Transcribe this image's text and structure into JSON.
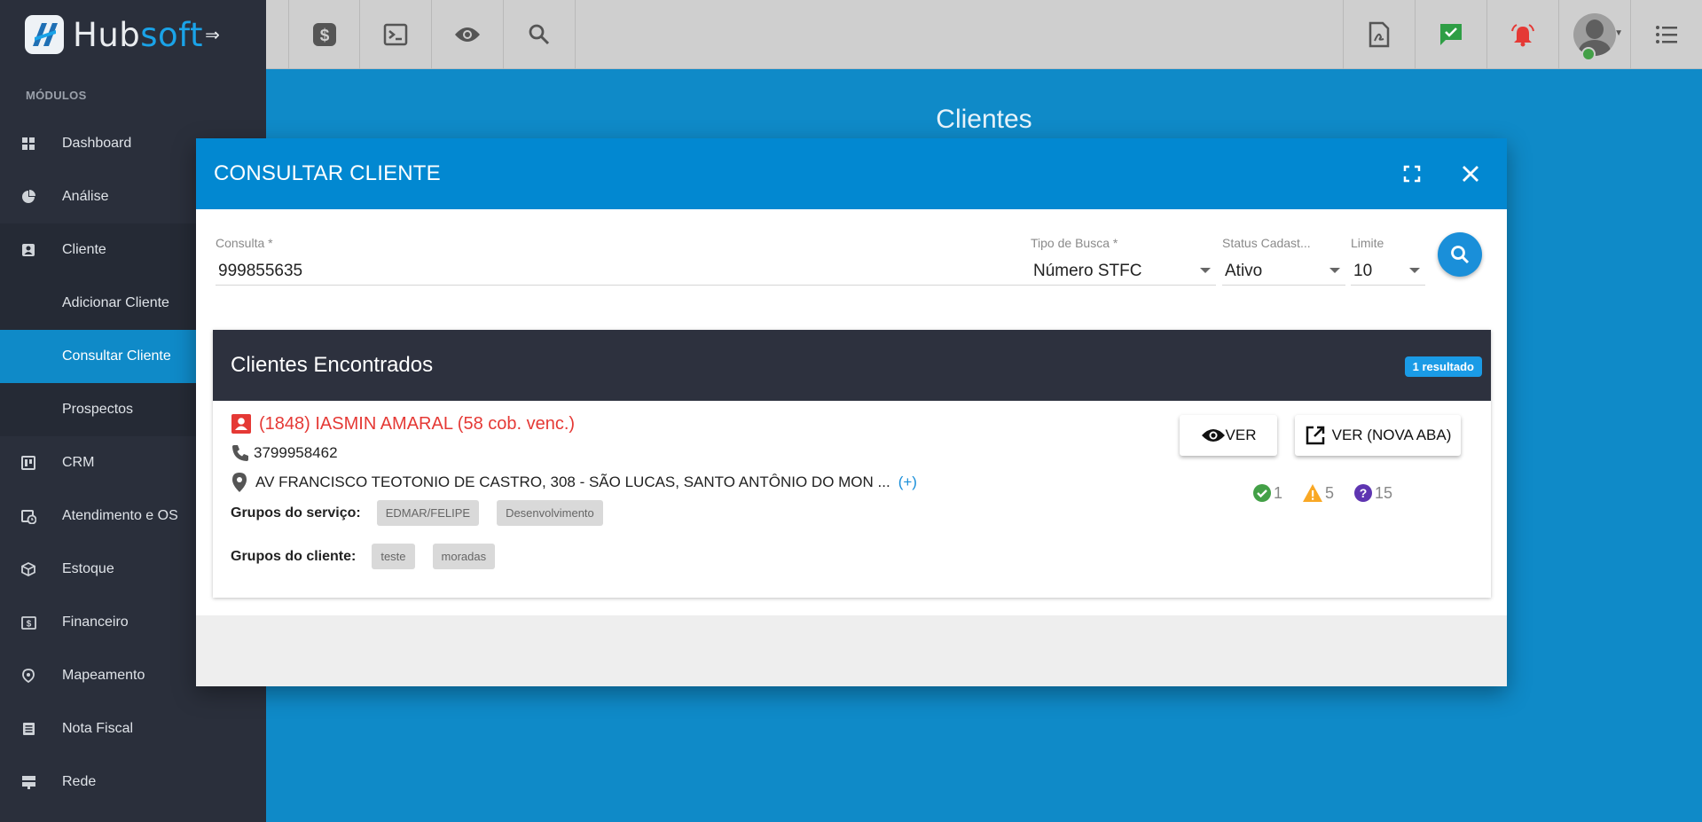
{
  "app": {
    "logo_hub": "Hub",
    "logo_soft": "soft",
    "page_title": "Clientes"
  },
  "toolbar": {
    "left_icons": [
      "dollar-icon",
      "terminal-icon",
      "eye-icon",
      "search-icon"
    ],
    "right_icons": [
      "pdf-icon",
      "check-chat-icon",
      "alarm-icon"
    ]
  },
  "sidebar": {
    "section_title": "MÓDULOS",
    "items": [
      {
        "label": "Dashboard",
        "icon": "dashboard-icon"
      },
      {
        "label": "Análise",
        "icon": "pie-chart-icon"
      },
      {
        "label": "Cliente",
        "icon": "contact-card-icon"
      },
      {
        "label": "Adicionar Cliente",
        "icon": ""
      },
      {
        "label": "Consultar Cliente",
        "icon": ""
      },
      {
        "label": "Prospectos",
        "icon": ""
      },
      {
        "label": "CRM",
        "icon": "kanban-icon"
      },
      {
        "label": "Atendimento e OS",
        "icon": "calendar-clock-icon"
      },
      {
        "label": "Estoque",
        "icon": "box-icon"
      },
      {
        "label": "Financeiro",
        "icon": "money-icon"
      },
      {
        "label": "Mapeamento",
        "icon": "map-pin-icon"
      },
      {
        "label": "Nota Fiscal",
        "icon": "document-icon"
      },
      {
        "label": "Rede",
        "icon": "server-icon"
      }
    ]
  },
  "modal": {
    "title": "CONSULTAR CLIENTE",
    "fields": {
      "consulta": {
        "label": "Consulta",
        "required": "*",
        "value": "999855635"
      },
      "tipo_busca": {
        "label": "Tipo de Busca",
        "required": "*",
        "value": "Número STFC"
      },
      "status": {
        "label": "Status Cadast...",
        "value": "Ativo"
      },
      "limite": {
        "label": "Limite",
        "value": "10"
      }
    },
    "results": {
      "title": "Clientes Encontrados",
      "badge": "1 resultado",
      "client": {
        "name": "(1848) IASMIN AMARAL (58 cob. venc.)",
        "phone": "3799958462",
        "address": "AV FRANCISCO TEOTONIO DE CASTRO, 308 - SÃO LUCAS, SANTO ANTÔNIO DO MON ...",
        "address_more": "(+)",
        "service_groups_label": "Grupos do serviço:",
        "service_groups": [
          "EDMAR/FELIPE",
          "Desenvolvimento"
        ],
        "client_groups_label": "Grupos do cliente:",
        "client_groups": [
          "teste",
          "moradas"
        ],
        "btn_view": "VER",
        "btn_view_new_tab": "VER (NOVA ABA)",
        "status_ok": "1",
        "status_warning": "5",
        "status_unknown": "15",
        "colors": {
          "name": "#e53935",
          "ok": "#43a047",
          "warning": "#f9a825",
          "unknown": "#5e35b1"
        }
      }
    }
  }
}
